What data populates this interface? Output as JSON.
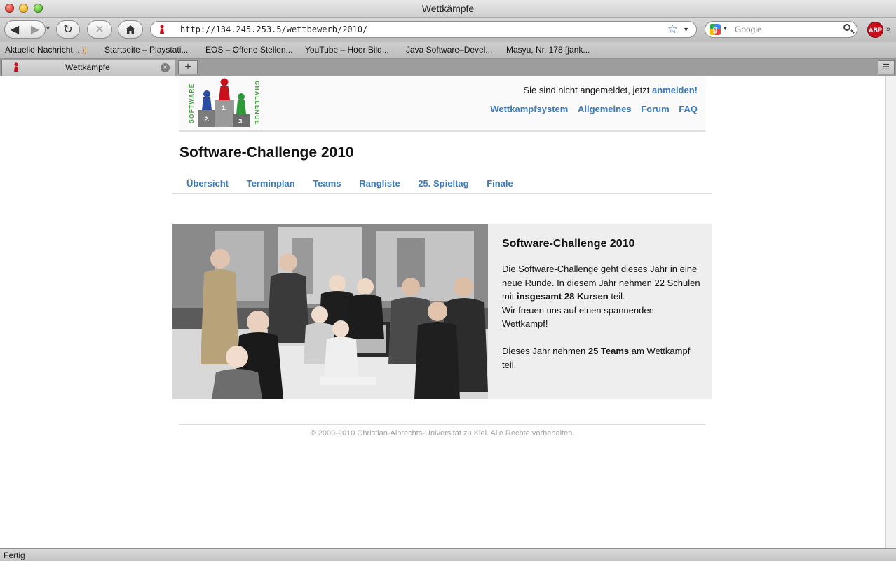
{
  "window": {
    "title": "Wettkämpfe"
  },
  "toolbar": {
    "url": "http://134.245.253.5/wettbewerb/2010/",
    "search_placeholder": "Google",
    "adblock_label": "ABP",
    "google_letter": "g"
  },
  "bookmarks": [
    "Aktuelle Nachricht...",
    "Startseite – Playstati...",
    "EOS – Offene Stellen...",
    "YouTube – Hoer Bild...",
    "Java Software–Devel...",
    "Masyu, Nr. 178 [jank..."
  ],
  "tab": {
    "title": "Wettkämpfe"
  },
  "page": {
    "login_prefix": "Sie sind nicht angemeldet, jetzt",
    "login_link": "anmelden!",
    "top_nav": [
      "Wettkampfsystem",
      "Allgemeines",
      "Forum",
      "FAQ"
    ],
    "logo_text_left": "SOFTWARE",
    "logo_text_right": "CHALLENGE",
    "podium_labels": [
      "2.",
      "1.",
      "3."
    ],
    "title": "Software-Challenge 2010",
    "sub_nav": [
      "Übersicht",
      "Terminplan",
      "Teams",
      "Rangliste",
      "25. Spieltag",
      "Finale"
    ],
    "info": {
      "title": "Software-Challenge 2010",
      "p1_a": "Die Software-Challenge geht dieses Jahr in eine neue Runde. In diesem Jahr nehmen 22 Schulen mit ",
      "p1_bold": "insgesamt 28 Kursen",
      "p1_b": " teil.",
      "p1_c": "Wir freuen uns auf einen spannenden Wettkampf!",
      "p2_a": "Dieses Jahr nehmen ",
      "p2_bold": "25 Teams",
      "p2_b": " am Wettkampf teil."
    },
    "footer": "© 2009-2010 Christian-Albrechts-Universität zu Kiel. Alle Rechte vorbehalten."
  },
  "status": {
    "text": "Fertig"
  },
  "colors": {
    "link": "#3a7bbf",
    "pawn_red": "#c8101c",
    "pawn_blue": "#2a4da0",
    "pawn_green": "#2f9a3a"
  }
}
